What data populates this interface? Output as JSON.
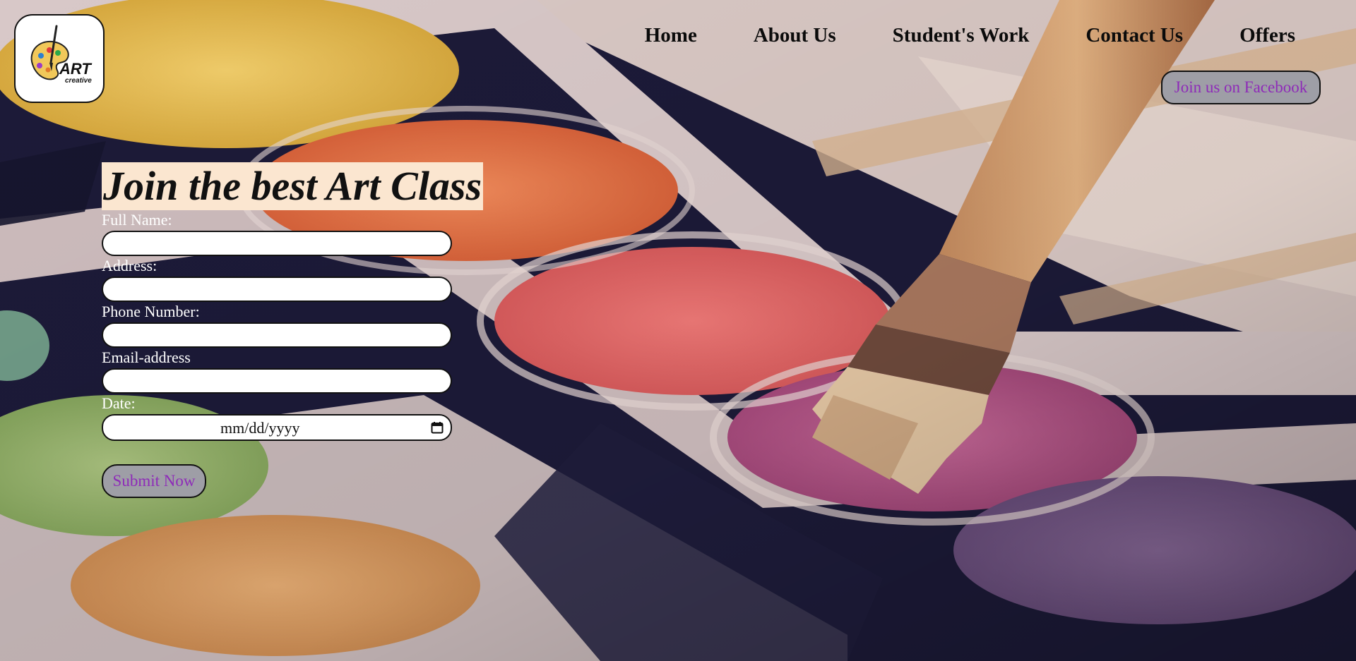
{
  "logo": {
    "word": "ART",
    "subword": "creative",
    "icon": "paint-palette-icon"
  },
  "nav": {
    "items": [
      {
        "label": "Home"
      },
      {
        "label": "About Us"
      },
      {
        "label": "Student's Work"
      },
      {
        "label": "Contact Us"
      },
      {
        "label": "Offers"
      }
    ]
  },
  "social": {
    "facebook_label": "Join us on Facebook"
  },
  "form": {
    "headline": "Join the best Art Class",
    "full_name_label": "Full Name:",
    "full_name_value": "",
    "address_label": "Address:",
    "address_value": "",
    "phone_label": "Phone Number:",
    "phone_value": "",
    "email_label": "Email-address",
    "email_value": "",
    "date_label": "Date:",
    "date_placeholder": "mm/dd/yyyy",
    "date_icon": "calendar-icon",
    "submit_label": "Submit Now"
  },
  "colors": {
    "button_bg": "#9e9ea6",
    "button_text": "#8e2bb8",
    "headline_bg": "#fbe6d0",
    "label_text": "#ffffff"
  }
}
